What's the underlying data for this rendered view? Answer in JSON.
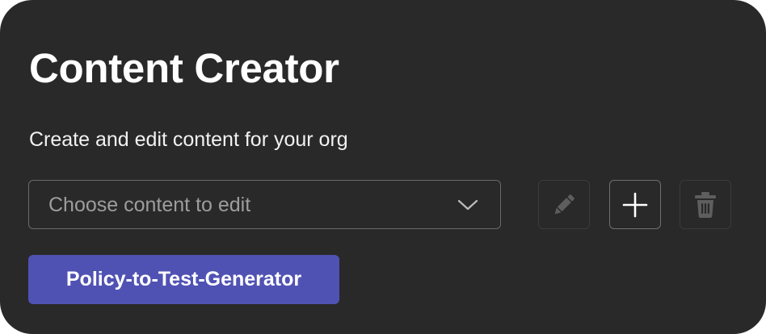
{
  "card": {
    "title": "Content Creator",
    "subtitle": "Create and edit content for your org"
  },
  "content_select": {
    "placeholder": "Choose content to edit",
    "icon": "chevron-down-icon"
  },
  "toolbar": {
    "edit_icon": "pencil-icon",
    "add_icon": "plus-icon",
    "delete_icon": "trash-icon"
  },
  "primary_action": {
    "label": "Policy-to-Test-Generator"
  },
  "colors": {
    "background": "#292929",
    "accent": "#5052b3",
    "text": "#ffffff",
    "placeholder": "#9d9d9d",
    "disabled_icon": "#5e5e5e"
  }
}
